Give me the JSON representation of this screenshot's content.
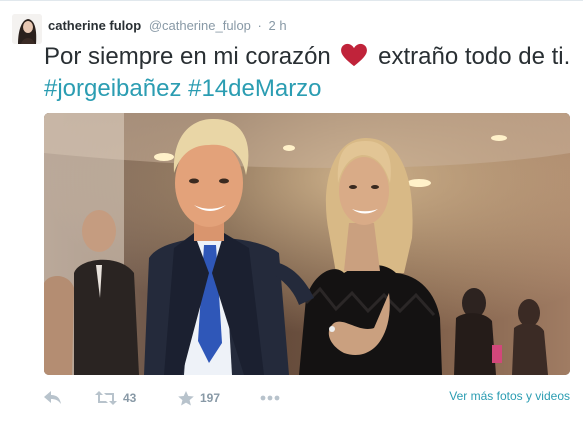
{
  "tweet": {
    "fullname": "catherine fulop",
    "username": "@catherine_fulop",
    "separator": "·",
    "time": "2 h",
    "text_before_heart": "Por siempre en mi corazón",
    "text_after_heart": " extraño todo de ti. ",
    "hashtags": [
      "#jorgeibañez",
      "#14deMarzo"
    ],
    "heart_color": "#c0233a",
    "accent_color": "#2b9db2"
  },
  "actions": {
    "reply_icon": "reply-icon",
    "retweet_icon": "retweet-icon",
    "retweet_count": "43",
    "favorite_icon": "star-icon",
    "favorite_count": "197",
    "more_icon": "more-dots-icon",
    "media_link": "Ver más fotos y videos"
  }
}
